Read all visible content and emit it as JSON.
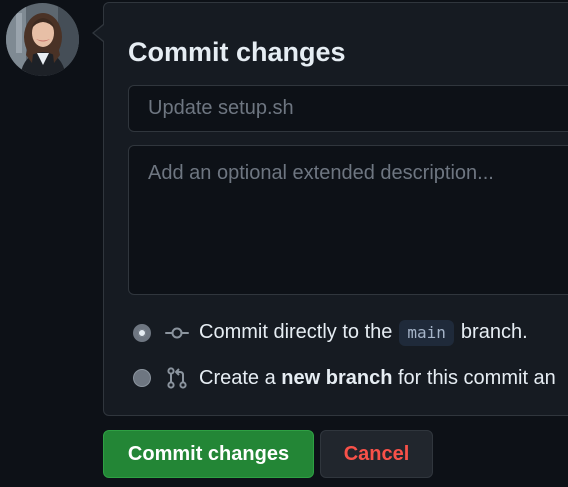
{
  "dialog": {
    "title": "Commit changes",
    "summary_placeholder": "Update setup.sh",
    "description_placeholder": "Add an optional extended description..."
  },
  "options": {
    "direct": {
      "selected": true,
      "prefix": "Commit directly to the",
      "branch": "main",
      "suffix": "branch."
    },
    "new_branch": {
      "selected": false,
      "prefix": "Create a",
      "bold": "new branch",
      "suffix": "for this commit an"
    }
  },
  "buttons": {
    "commit": "Commit changes",
    "cancel": "Cancel"
  },
  "icons": {
    "commit": "git-commit-icon",
    "pull_request": "git-pull-request-icon"
  },
  "colors": {
    "background": "#0d1117",
    "panel": "#161b22",
    "border": "#30363d",
    "primary_green": "#238636",
    "danger_red": "#f85149"
  }
}
